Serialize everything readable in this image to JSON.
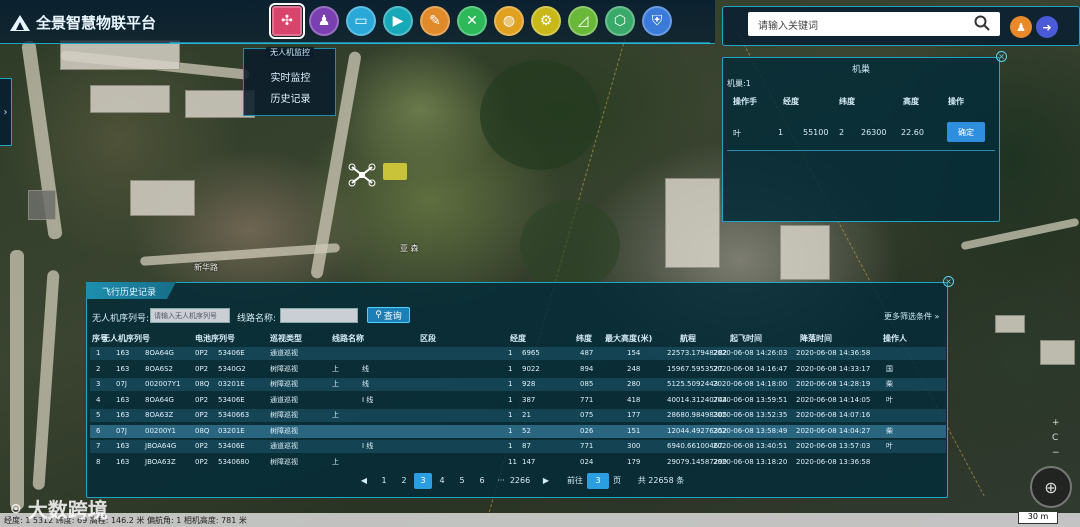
{
  "app": {
    "title": "全景智慧物联平台"
  },
  "nav": {
    "icons": [
      {
        "name": "drone-monitor-icon",
        "glyph": "✣",
        "color": "#d9446c",
        "active": true
      },
      {
        "name": "person-icon",
        "glyph": "♟",
        "color": "#7a3fb0"
      },
      {
        "name": "window-icon",
        "glyph": "▭",
        "color": "#2aa8d8"
      },
      {
        "name": "video-icon",
        "glyph": "▶",
        "color": "#18a9b8"
      },
      {
        "name": "map-icon",
        "glyph": "✎",
        "color": "#e08a2a"
      },
      {
        "name": "tools-icon",
        "glyph": "✕",
        "color": "#2db85a"
      },
      {
        "name": "globe-icon",
        "glyph": "◍",
        "color": "#e0a020"
      },
      {
        "name": "gear-icon",
        "glyph": "⚙",
        "color": "#c8b818"
      },
      {
        "name": "chart-icon",
        "glyph": "◿",
        "color": "#6ab83a"
      },
      {
        "name": "cube-icon",
        "glyph": "⬡",
        "color": "#3aaa6a"
      },
      {
        "name": "shield-icon",
        "glyph": "⛨",
        "color": "#3a7ad8"
      }
    ],
    "dropdown": {
      "title": "无人机监控",
      "items": [
        "实时监控",
        "历史记录"
      ]
    }
  },
  "search": {
    "placeholder": "请输入关键词"
  },
  "user_colors": {
    "user": "#e88a2a",
    "logout": "#4a5ad8"
  },
  "drone_panel": {
    "title": "机巢",
    "subtitle": "机巢:1",
    "headers": [
      "操作手",
      "经度",
      "纬度",
      "高度",
      "操作"
    ],
    "row": {
      "operator": "叶",
      "lng_a": "1",
      "lng_b": "55100",
      "lat_a": "2",
      "lat_b": "26300",
      "height": "22.60",
      "action": "确定"
    }
  },
  "history": {
    "tab": "飞行历史记录",
    "serial_label": "无人机序列号:",
    "serial_placeholder": "请输入无人机序列号",
    "line_label": "线路名称:",
    "query": "查询",
    "more_filters": "更多筛选条件 »",
    "headers": [
      "序号",
      "无人机序列号",
      "电池序列号",
      "巡视类型",
      "线路名称",
      "区段",
      "经度",
      "纬度",
      "最大高度(米)",
      "航程",
      "起飞时间",
      "降落时间",
      "操作人"
    ],
    "rows": [
      [
        "1",
        "163",
        "8OA64G",
        "0P2",
        "53406E",
        "通道巡视",
        "",
        "",
        "1",
        "6965",
        "487",
        "154",
        "22573.17948282",
        "2020-06-08 14:26:03",
        "2020-06-08 14:36:58",
        ""
      ],
      [
        "2",
        "163",
        "8OA6S2",
        "0P2",
        "5340G2",
        "树障巡视",
        "上",
        "线",
        "1",
        "9022",
        "894",
        "248",
        "15967.5953527",
        "2020-06-08 14:16:47",
        "2020-06-08 14:33:17",
        "国"
      ],
      [
        "3",
        "07J",
        "002007Y1",
        "08Q",
        "03201E",
        "树障巡视",
        "上",
        "线",
        "1",
        "928",
        "085",
        "280",
        "5125.5092443",
        "2020-06-08 14:18:00",
        "2020-06-08 14:28:19",
        "柴"
      ],
      [
        "4",
        "163",
        "8OA64G",
        "0P2",
        "53406E",
        "通道巡视",
        "",
        "I 线",
        "1",
        "387",
        "771",
        "418",
        "40014.31240744",
        "2020-06-08 13:59:51",
        "2020-06-08 14:14:05",
        "叶"
      ],
      [
        "5",
        "163",
        "8OA63Z",
        "0P2",
        "5340663",
        "树障巡视",
        "上",
        "",
        "1",
        "21",
        "075",
        "177",
        "28680.98498305",
        "2020-06-08 13:52:35",
        "2020-06-08 14:07:16",
        ""
      ],
      [
        "6",
        "07J",
        "00200Y1",
        "08Q",
        "03201E",
        "树障巡视",
        "",
        "",
        "1",
        "52",
        "026",
        "151",
        "12044.49276352",
        "2020-06-08 13:58:49",
        "2020-06-08 14:04:27",
        "柴"
      ],
      [
        "7",
        "163",
        "JBOA64G",
        "0P2",
        "53406E",
        "通道巡视",
        "",
        "I 线",
        "1",
        "87",
        "771",
        "300",
        "6940.66100467",
        "2020-06-08 13:40:51",
        "2020-06-08 13:57:03",
        "叶"
      ],
      [
        "8",
        "163",
        "JBOA63Z",
        "0P2",
        "5340680",
        "树障巡视",
        "上",
        "",
        "11",
        "147",
        "024",
        "179",
        "29079.14587299",
        "2020-06-08 13:18:20",
        "2020-06-08 13:36:58",
        ""
      ]
    ],
    "pager": {
      "pages": [
        "1",
        "2",
        "3",
        "4",
        "5",
        "6",
        "···",
        "2266"
      ],
      "current": "3",
      "goto_label": "前往",
      "goto_value": "3",
      "page_unit": "页",
      "total": "共 22658 条"
    }
  },
  "status": {
    "text": "经度: 1    5312 纬度:         69 高程: 146.2 米 偏航角: 1 相机高度: 781 米"
  },
  "scale": "30 m",
  "watermark": "大数跨境",
  "map_labels": {
    "a": "新华路",
    "b": "亚 森"
  }
}
